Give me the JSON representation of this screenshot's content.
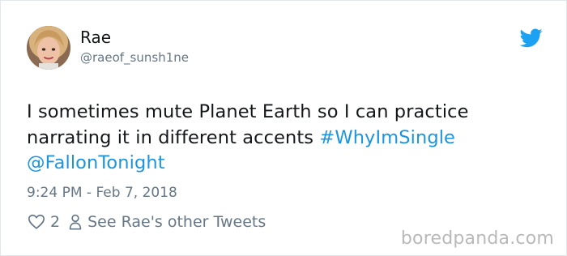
{
  "user": {
    "display_name": "Rae",
    "handle": "@raeof_sunsh1ne"
  },
  "tweet": {
    "text_before": "I sometimes mute Planet Earth so I can practice narrating it in different accents ",
    "hashtag": "#WhyImSingle",
    "mention": "@FallonTonight",
    "timestamp": "9:24 PM - Feb 7, 2018"
  },
  "actions": {
    "like_count": "2",
    "see_tweets_label": "See Rae's other Tweets"
  },
  "watermark": "boredpanda.com",
  "icons": {
    "brand": "twitter-bird-icon",
    "like": "heart-icon",
    "profile": "person-icon"
  },
  "colors": {
    "link": "#1b95e0",
    "secondary_text": "#657786",
    "primary_text": "#14171a",
    "twitter_blue": "#1da1f2"
  }
}
